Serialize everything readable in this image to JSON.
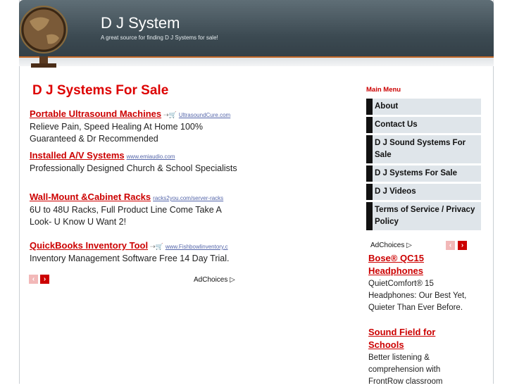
{
  "site": {
    "title": "D J System",
    "tagline": "A great source for finding D J Systems for sale!"
  },
  "main": {
    "heading": "D J Systems For Sale",
    "ads": [
      {
        "title": "Portable Ultrasound Machines",
        "url": "UltrasoundCure.com",
        "desc": "Relieve Pain, Speed Healing At Home 100% Guaranteed & Dr Recommended"
      },
      {
        "title": "Installed A/V Systems",
        "url": "www.emiaudio.com",
        "desc": "Professionally Designed Church & School Specialists"
      },
      {
        "title": "Wall-Mount &Cabinet Racks",
        "url": "racks2you.com/server-racks",
        "desc": "6U to 48U Racks, Full Product Line Come Take A Look- U Know U Want 2!"
      },
      {
        "title": "QuickBooks Inventory Tool",
        "url": "www.Fishbowlinventory.c",
        "desc": "Inventory Management Software Free 14 Day Trial."
      }
    ],
    "adchoices": "AdChoices",
    "prev_label": "‹",
    "next_label": "›"
  },
  "sidebar": {
    "menu_title": "Main Menu",
    "menu": [
      {
        "label": "About"
      },
      {
        "label": "Contact Us"
      },
      {
        "label": "D J Sound Systems For Sale"
      },
      {
        "label": "D J Systems For Sale"
      },
      {
        "label": "D J Videos"
      },
      {
        "label": "Terms of Service / Privacy Policy"
      }
    ],
    "adchoices": "AdChoices",
    "prev_label": "‹",
    "next_label": "›",
    "ads": [
      {
        "title": "Bose® QC15 Headphones",
        "desc": "QuietComfort® 15 Headphones: Our Best Yet, Quieter Than Ever Before."
      },
      {
        "title": "Sound Field for Schools",
        "desc": "Better listening & comprehension with FrontRow classroom"
      }
    ]
  },
  "colors": {
    "accent": "#cc0000",
    "header": "#3c4a52",
    "menu_bg": "#dfe5ea"
  }
}
